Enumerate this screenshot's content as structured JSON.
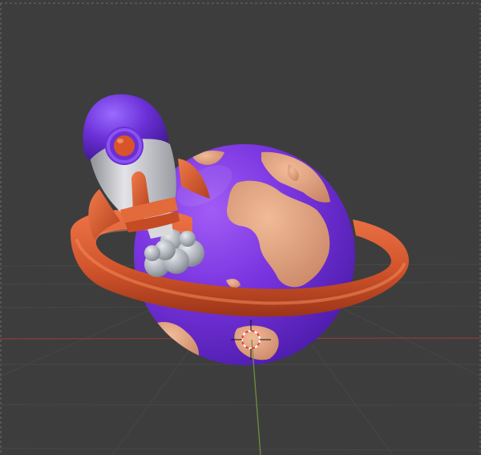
{
  "viewport": {
    "view": "perspective",
    "background_color": "#3d3d3d",
    "grid_visible": true,
    "x_axis_color": "#8a3d3d",
    "y_axis_color": "#6e8f3c"
  },
  "scene": {
    "objects": [
      {
        "name": "planet",
        "color": "#7a35e0",
        "continent_color": "#e3a07f"
      },
      {
        "name": "ring",
        "color": "#d2552c"
      },
      {
        "name": "rocket",
        "nose_color": "#6b2fd6",
        "body_color": "#c8c8cc",
        "fin_color": "#d2552c"
      },
      {
        "name": "exhaust-cloud",
        "color": "#a8acb4"
      }
    ]
  },
  "cursor": {
    "name": "3d-cursor",
    "colors": [
      "#e04040",
      "#ffffff"
    ]
  }
}
